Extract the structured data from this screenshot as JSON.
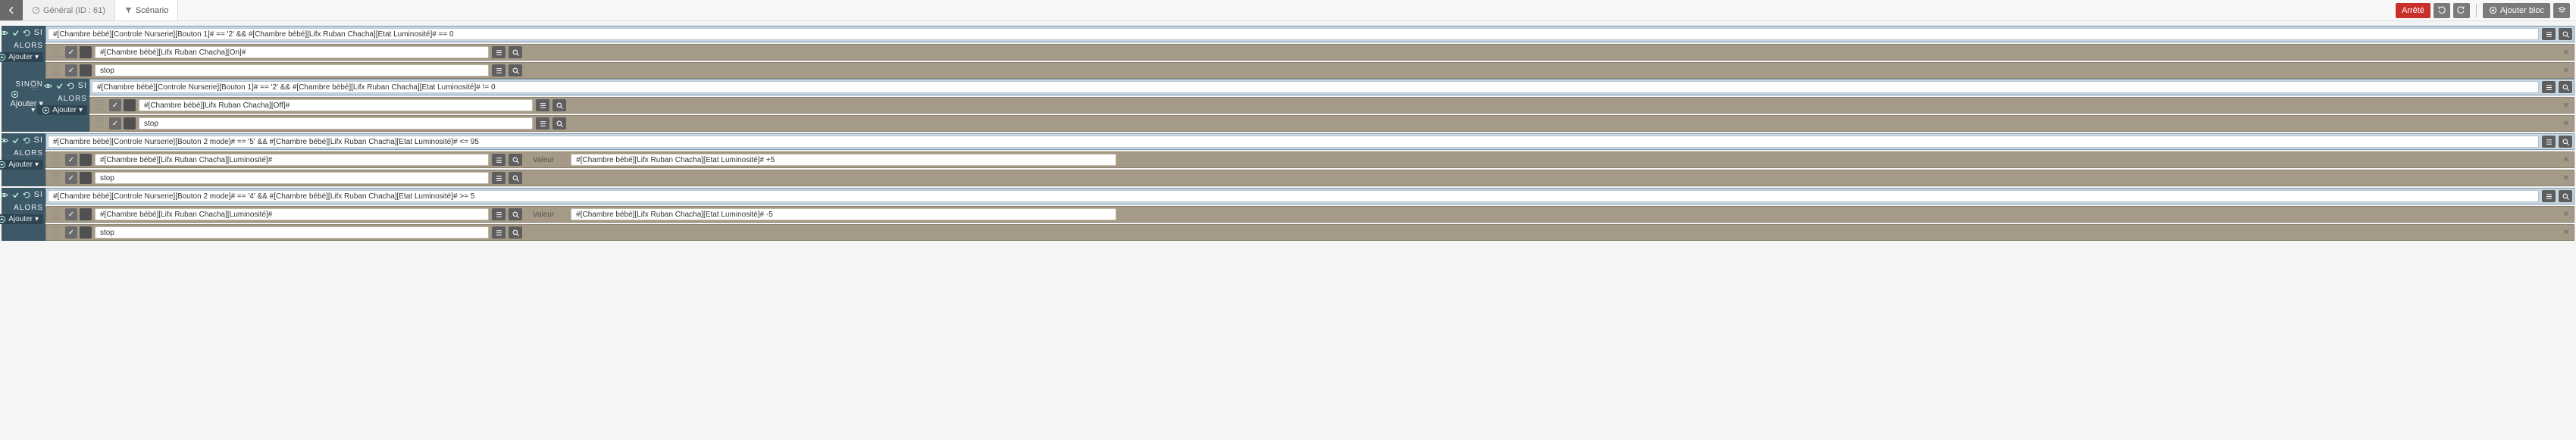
{
  "topbar": {
    "tab_general": "Général (ID : 61)",
    "tab_scenario": "Scénario",
    "status_btn": "Arrêté",
    "add_block_btn": "Ajouter bloc"
  },
  "labels": {
    "si": "SI",
    "alors": "ALORS",
    "sinon": "SINON",
    "ajouter": "Ajouter",
    "valeur": "Valeur"
  },
  "block1": {
    "condition": "#[Chambre bébé][Controle Nurserie][Bouton 1]# == '2' && #[Chambre bébé][Lifx Ruban Chacha][Etat Luminosité]# == 0",
    "actions": [
      {
        "cmd": "#[Chambre bébé][Lifx Ruban Chacha][On]#"
      },
      {
        "cmd": "stop"
      }
    ],
    "sinon": {
      "condition": "#[Chambre bébé][Controle Nurserie][Bouton 1]# == '2' && #[Chambre bébé][Lifx Ruban Chacha][Etat Luminosité]# != 0",
      "actions": [
        {
          "cmd": "#[Chambre bébé][Lifx Ruban Chacha][Off]#"
        },
        {
          "cmd": "stop"
        }
      ]
    }
  },
  "block2": {
    "condition": "#[Chambre bébé][Controle Nurserie][Bouton 2 mode]# == '5' && #[Chambre bébé][Lifx Ruban Chacha][Etat Luminosité]# <= 95",
    "actions": [
      {
        "cmd": "#[Chambre bébé][Lifx Ruban Chacha][Luminosité]#",
        "value": "#[Chambre bébé][Lifx Ruban Chacha][Etat Luminosité]# +5"
      },
      {
        "cmd": "stop"
      }
    ]
  },
  "block3": {
    "condition": "#[Chambre bébé][Controle Nurserie][Bouton 2 mode]# == '4' && #[Chambre bébé][Lifx Ruban Chacha][Etat Luminosité]# >= 5",
    "actions": [
      {
        "cmd": "#[Chambre bébé][Lifx Ruban Chacha][Luminosité]#",
        "value": "#[Chambre bébé][Lifx Ruban Chacha][Etat Luminosité]# -5"
      },
      {
        "cmd": "stop"
      }
    ]
  }
}
